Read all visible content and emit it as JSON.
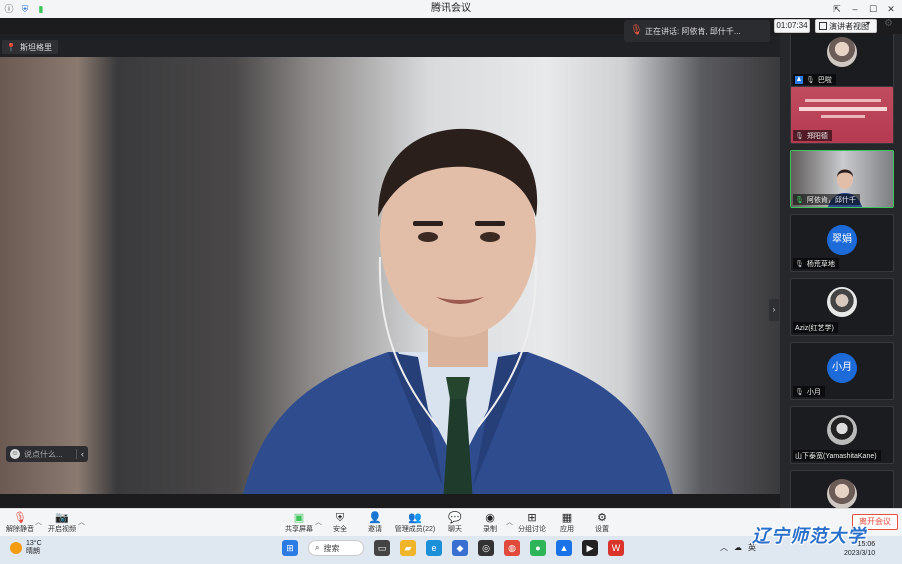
{
  "window": {
    "title": "腾讯会议"
  },
  "speaking_banner": {
    "text": "正在讲话: 阿依肯, 邱什千..."
  },
  "meeting_timer": "01:07:34",
  "view_button": {
    "label": "演讲者视图"
  },
  "main_video": {
    "speaker_tag": "斯坦格里"
  },
  "chat": {
    "placeholder": "说点什么...",
    "collapse_arrow": "‹"
  },
  "panel_collapse": "›",
  "participants": [
    {
      "name": "巴啦",
      "type": "photo",
      "host": true
    },
    {
      "name": "郑阳德",
      "type": "slide"
    },
    {
      "name": "阿依肯，邱什千",
      "type": "video",
      "speaking": true
    },
    {
      "name": "杨荒草地",
      "type": "avatar",
      "avatar_text": "翠娟",
      "avatar_color": "#1c6bd9"
    },
    {
      "name": "Aziz(红艺学)",
      "type": "photo2"
    },
    {
      "name": "小月",
      "type": "avatar",
      "avatar_text": "小月",
      "avatar_color": "#1c6bd9"
    },
    {
      "name": "山下泰宽(YamashitaKane)",
      "type": "photo3"
    },
    {
      "name": "",
      "type": "photo"
    }
  ],
  "toolbar": {
    "mute": "解除静音",
    "video": "开启视频",
    "share": "共享屏幕",
    "security": "安全",
    "invite": "邀请",
    "members": "管理成员(22)",
    "chat": "聊天",
    "record": "录制",
    "breakout": "分组讨论",
    "apps": "应用",
    "settings": "设置",
    "leave": "离开会议"
  },
  "taskbar": {
    "weather_temp": "13°C",
    "weather_desc": "晴朗",
    "search": "搜索",
    "tray_lang": "英",
    "clock_time": "15:06",
    "clock_date": "2023/3/10"
  },
  "watermark": "辽宁师范大学",
  "colors": {
    "accent_blue": "#1c6bd9",
    "active_green": "#3cc55a",
    "leave_red": "#e74c3c"
  }
}
